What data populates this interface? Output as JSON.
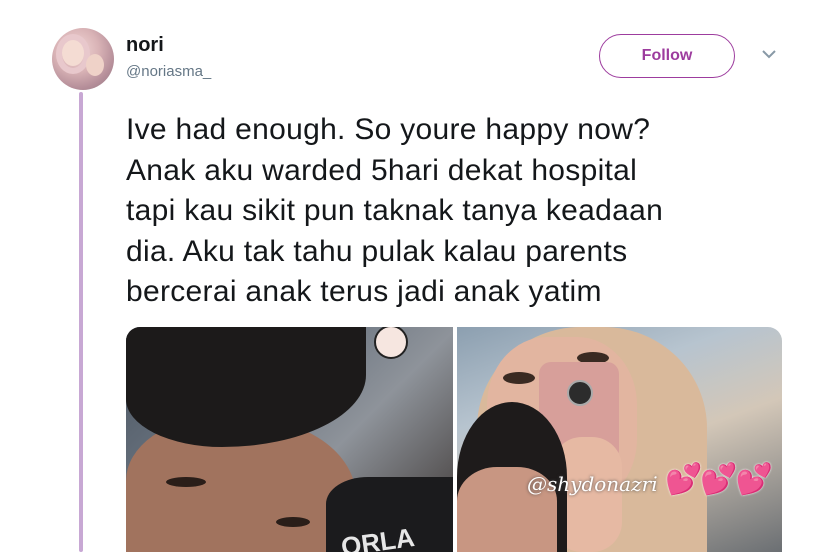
{
  "tweet": {
    "display_name": "nori",
    "handle": "@noriasma_",
    "follow_label": "Follow",
    "text_lines": [
      "Ive had enough. So youre happy now?",
      "Anak aku warded 5hari dekat hospital",
      "tapi kau sikit pun taknak tanya keadaan",
      "dia. Aku tak tahu pulak kalau parents",
      "bercerai anak terus jadi anak yatim"
    ],
    "media": {
      "left_photo_shirt_text": "ORLA",
      "right_photo_watermark": "@shydonazri",
      "right_photo_stickers": "💕💕💕"
    }
  },
  "colors": {
    "accent": "#9d3c9e",
    "thread_line": "#c8a8d4",
    "text_primary": "#14171a",
    "text_secondary": "#657786"
  },
  "icons": {
    "more": "chevron-down-icon"
  }
}
